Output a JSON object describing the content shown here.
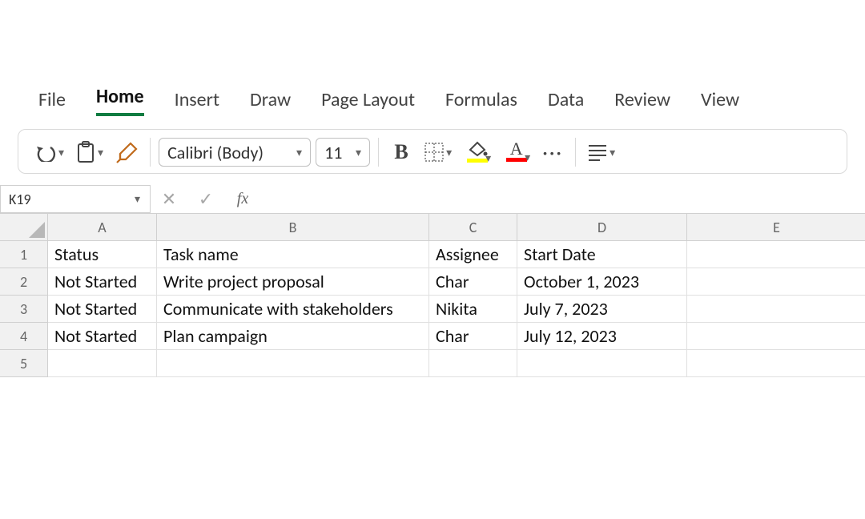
{
  "ribbon": {
    "tabs": [
      "File",
      "Home",
      "Insert",
      "Draw",
      "Page Layout",
      "Formulas",
      "Data",
      "Review",
      "View"
    ],
    "active": "Home"
  },
  "toolbar": {
    "font_name": "Calibri (Body)",
    "font_size": "11",
    "bold_label": "B",
    "fill_color": "#ffff00",
    "font_color": "#ff0000",
    "more": "···"
  },
  "formula_bar": {
    "cell_ref": "K19",
    "formula": ""
  },
  "sheet": {
    "col_letters": [
      "A",
      "B",
      "C",
      "D",
      "E"
    ],
    "row_numbers": [
      "1",
      "2",
      "3",
      "4",
      "5"
    ],
    "rows": [
      {
        "A": "Status",
        "B": "Task name",
        "C": "Assignee",
        "D": "Start Date",
        "E": ""
      },
      {
        "A": "Not Started",
        "B": "Write project proposal",
        "C": "Char",
        "D": "October 1, 2023",
        "E": ""
      },
      {
        "A": "Not Started",
        "B": "Communicate with stakeholders",
        "C": "Nikita",
        "D": "July 7, 2023",
        "E": ""
      },
      {
        "A": "Not Started",
        "B": "Plan campaign",
        "C": "Char",
        "D": "July 12, 2023",
        "E": ""
      },
      {
        "A": "",
        "B": "",
        "C": "",
        "D": "",
        "E": ""
      }
    ]
  }
}
